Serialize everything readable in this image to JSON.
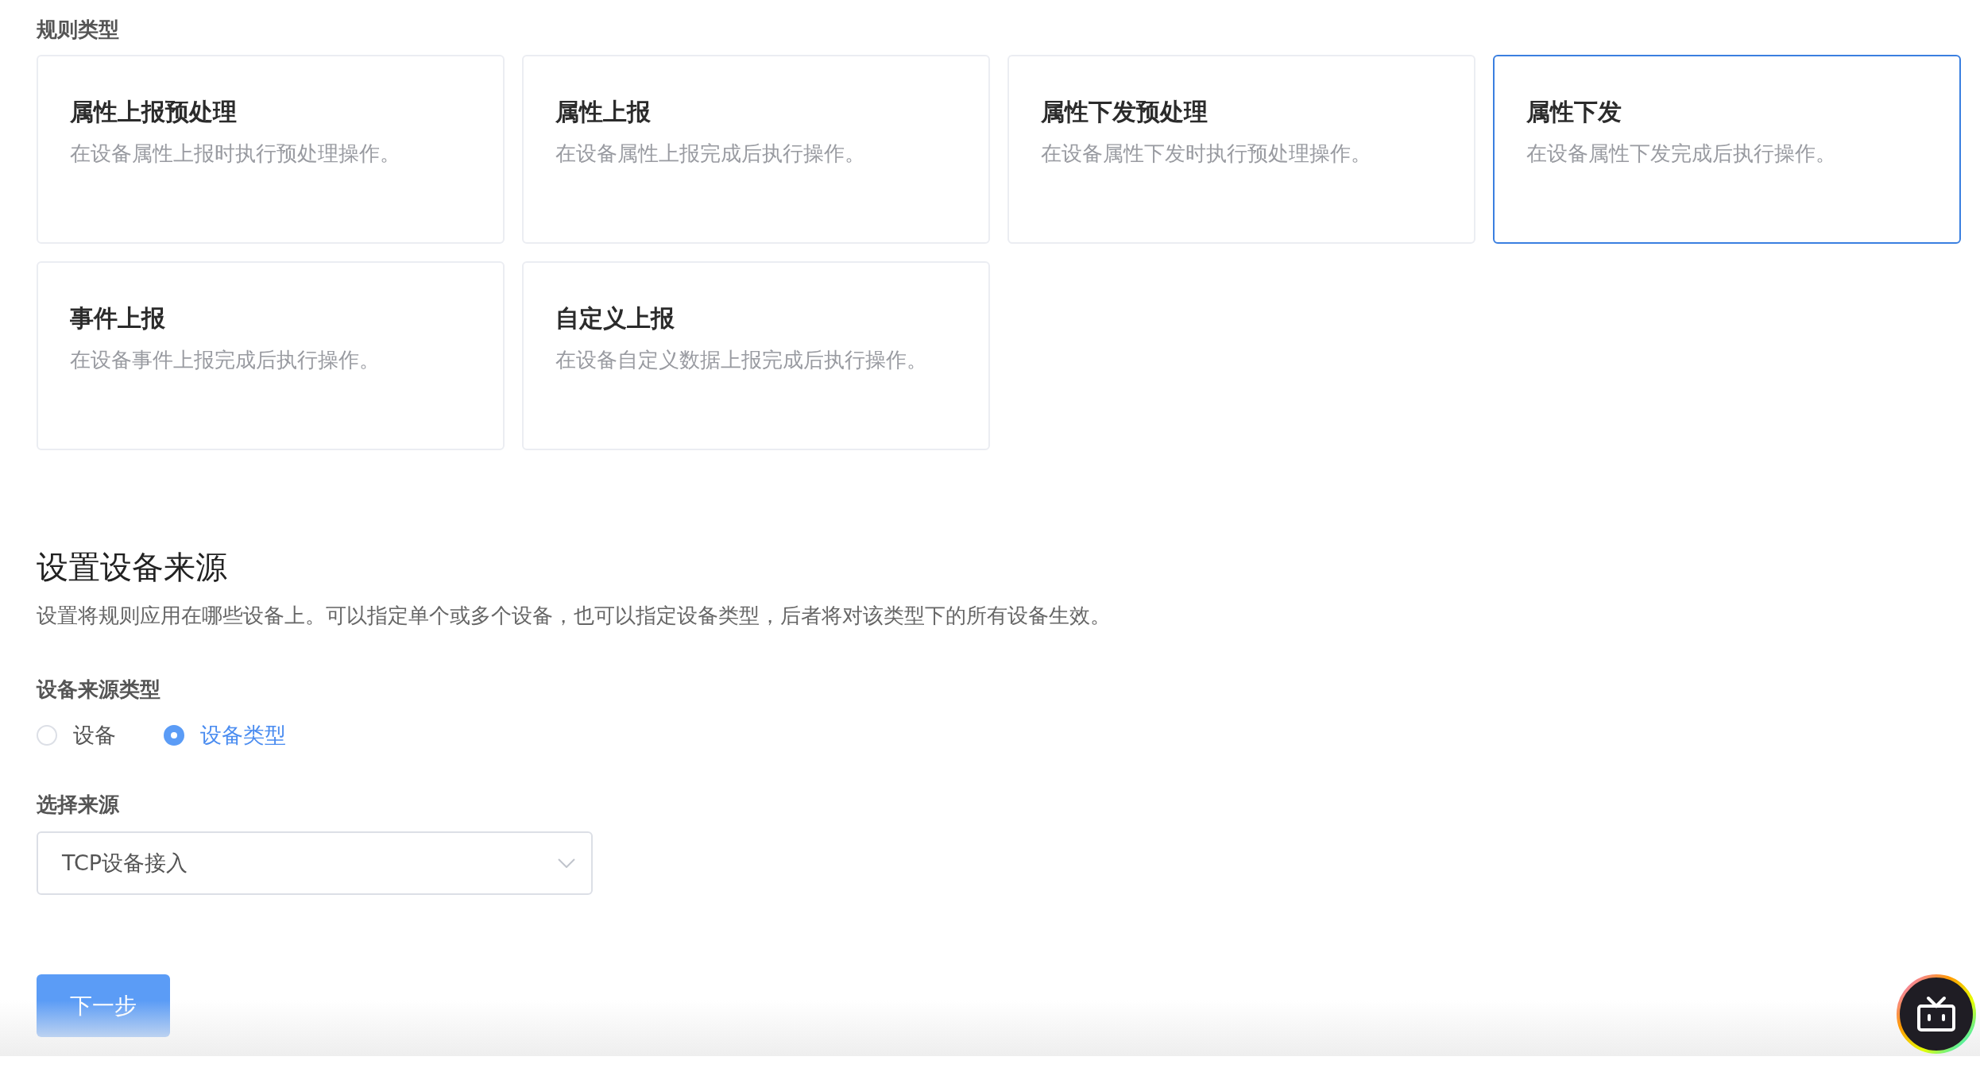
{
  "rule_type": {
    "label": "规则类型",
    "options": [
      {
        "title": "属性上报预处理",
        "description": "在设备属性上报时执行预处理操作。",
        "selected": false
      },
      {
        "title": "属性上报",
        "description": "在设备属性上报完成后执行操作。",
        "selected": false
      },
      {
        "title": "属性下发预处理",
        "description": "在设备属性下发时执行预处理操作。",
        "selected": false
      },
      {
        "title": "属性下发",
        "description": "在设备属性下发完成后执行操作。",
        "selected": true
      },
      {
        "title": "事件上报",
        "description": "在设备事件上报完成后执行操作。",
        "selected": false
      },
      {
        "title": "自定义上报",
        "description": "在设备自定义数据上报完成后执行操作。",
        "selected": false
      }
    ]
  },
  "device_source": {
    "title": "设置设备来源",
    "description": "设置将规则应用在哪些设备上。可以指定单个或多个设备，也可以指定设备类型，后者将对该类型下的所有设备生效。",
    "source_type": {
      "label": "设备来源类型",
      "options": [
        {
          "label": "设备",
          "selected": false
        },
        {
          "label": "设备类型",
          "selected": true
        }
      ]
    },
    "select_source": {
      "label": "选择来源",
      "value": "TCP设备接入"
    }
  },
  "next_button": "下一步"
}
